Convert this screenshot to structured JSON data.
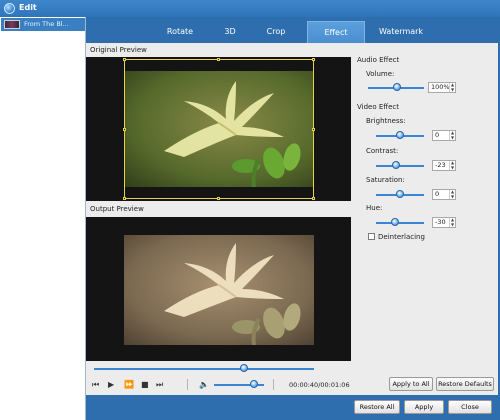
{
  "window": {
    "title": "Edit"
  },
  "file_list": {
    "items": [
      {
        "name": "From The Bl..."
      }
    ]
  },
  "tabs": [
    {
      "label": "Rotate",
      "active": false
    },
    {
      "label": "3D",
      "active": false
    },
    {
      "label": "Crop",
      "active": false
    },
    {
      "label": "Effect",
      "active": true
    },
    {
      "label": "Watermark",
      "active": false
    }
  ],
  "preview": {
    "original_label": "Original Preview",
    "output_label": "Output Preview"
  },
  "audio_effect": {
    "heading": "Audio Effect",
    "volume_label": "Volume:",
    "volume_value": "100%",
    "volume_level": 0.5
  },
  "video_effect": {
    "heading": "Video Effect",
    "brightness_label": "Brightness:",
    "brightness_value": "0",
    "brightness_level": 0.5,
    "contrast_label": "Contrast:",
    "contrast_value": "-23",
    "contrast_level": 0.38,
    "saturation_label": "Saturation:",
    "saturation_value": "0",
    "saturation_level": 0.5,
    "hue_label": "Hue:",
    "hue_value": "-30",
    "hue_level": 0.35,
    "deinterlacing_label": "Deinterlacing",
    "deinterlacing_checked": false
  },
  "buttons": {
    "apply_to_all": "Apply to All",
    "restore_defaults": "Restore Defaults",
    "restore_all": "Restore All",
    "apply": "Apply",
    "close": "Close"
  },
  "playback": {
    "seek_position": 0.7,
    "volume_level": 0.75,
    "time": "00:00:40/00:01:06"
  },
  "icons": {
    "app": "app-logo-icon",
    "prev": "skip-previous-icon",
    "play": "play-icon",
    "forward": "fast-forward-icon",
    "stop": "stop-icon",
    "next": "skip-next-icon",
    "volume": "speaker-icon"
  }
}
